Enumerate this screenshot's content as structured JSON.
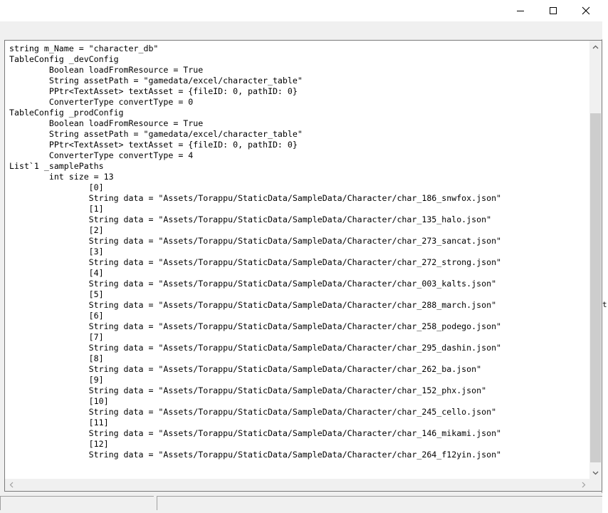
{
  "window": {
    "controls": {
      "minimize_icon": "minimize-icon",
      "maximize_icon": "maximize-icon",
      "close_icon": "close-icon"
    }
  },
  "dump": {
    "lines": [
      "string m_Name = \"character_db\"",
      "TableConfig _devConfig",
      "\tBoolean loadFromResource = True",
      "\tString assetPath = \"gamedata/excel/character_table\"",
      "\tPPtr<TextAsset> textAsset = {fileID: 0, pathID: 0}",
      "\tConverterType convertType = 0",
      "TableConfig _prodConfig",
      "\tBoolean loadFromResource = True",
      "\tString assetPath = \"gamedata/excel/character_table\"",
      "\tPPtr<TextAsset> textAsset = {fileID: 0, pathID: 0}",
      "\tConverterType convertType = 4",
      "List`1 _samplePaths",
      "\tint size = 13",
      "\t\t[0]",
      "\t\tString data = \"Assets/Torappu/StaticData/SampleData/Character/char_186_snwfox.json\"",
      "\t\t[1]",
      "\t\tString data = \"Assets/Torappu/StaticData/SampleData/Character/char_135_halo.json\"",
      "\t\t[2]",
      "\t\tString data = \"Assets/Torappu/StaticData/SampleData/Character/char_273_sancat.json\"",
      "\t\t[3]",
      "\t\tString data = \"Assets/Torappu/StaticData/SampleData/Character/char_272_strong.json\"",
      "\t\t[4]",
      "\t\tString data = \"Assets/Torappu/StaticData/SampleData/Character/char_003_kalts.json\"",
      "\t\t[5]",
      "\t\tString data = \"Assets/Torappu/StaticData/SampleData/Character/char_288_march.json\"",
      "\t\t[6]",
      "\t\tString data = \"Assets/Torappu/StaticData/SampleData/Character/char_258_podego.json\"",
      "\t\t[7]",
      "\t\tString data = \"Assets/Torappu/StaticData/SampleData/Character/char_295_dashin.json\"",
      "\t\t[8]",
      "\t\tString data = \"Assets/Torappu/StaticData/SampleData/Character/char_262_ba.json\"",
      "\t\t[9]",
      "\t\tString data = \"Assets/Torappu/StaticData/SampleData/Character/char_152_phx.json\"",
      "\t\t[10]",
      "\t\tString data = \"Assets/Torappu/StaticData/SampleData/Character/char_245_cello.json\"",
      "\t\t[11]",
      "\t\tString data = \"Assets/Torappu/StaticData/SampleData/Character/char_146_mikami.json\"",
      "\t\t[12]",
      "\t\tString data = \"Assets/Torappu/StaticData/SampleData/Character/char_264_f12yin.json\""
    ]
  },
  "scrollbars": {
    "up_icon": "chevron-up-icon",
    "down_icon": "chevron-down-icon",
    "left_icon": "chevron-left-icon",
    "right_icon": "chevron-right-icon"
  },
  "background": {
    "glyph": "t,"
  },
  "colors": {
    "window_bg": "#f0f0f0",
    "text_bg": "#ffffff",
    "scroll_thumb": "#cdcdcd"
  }
}
